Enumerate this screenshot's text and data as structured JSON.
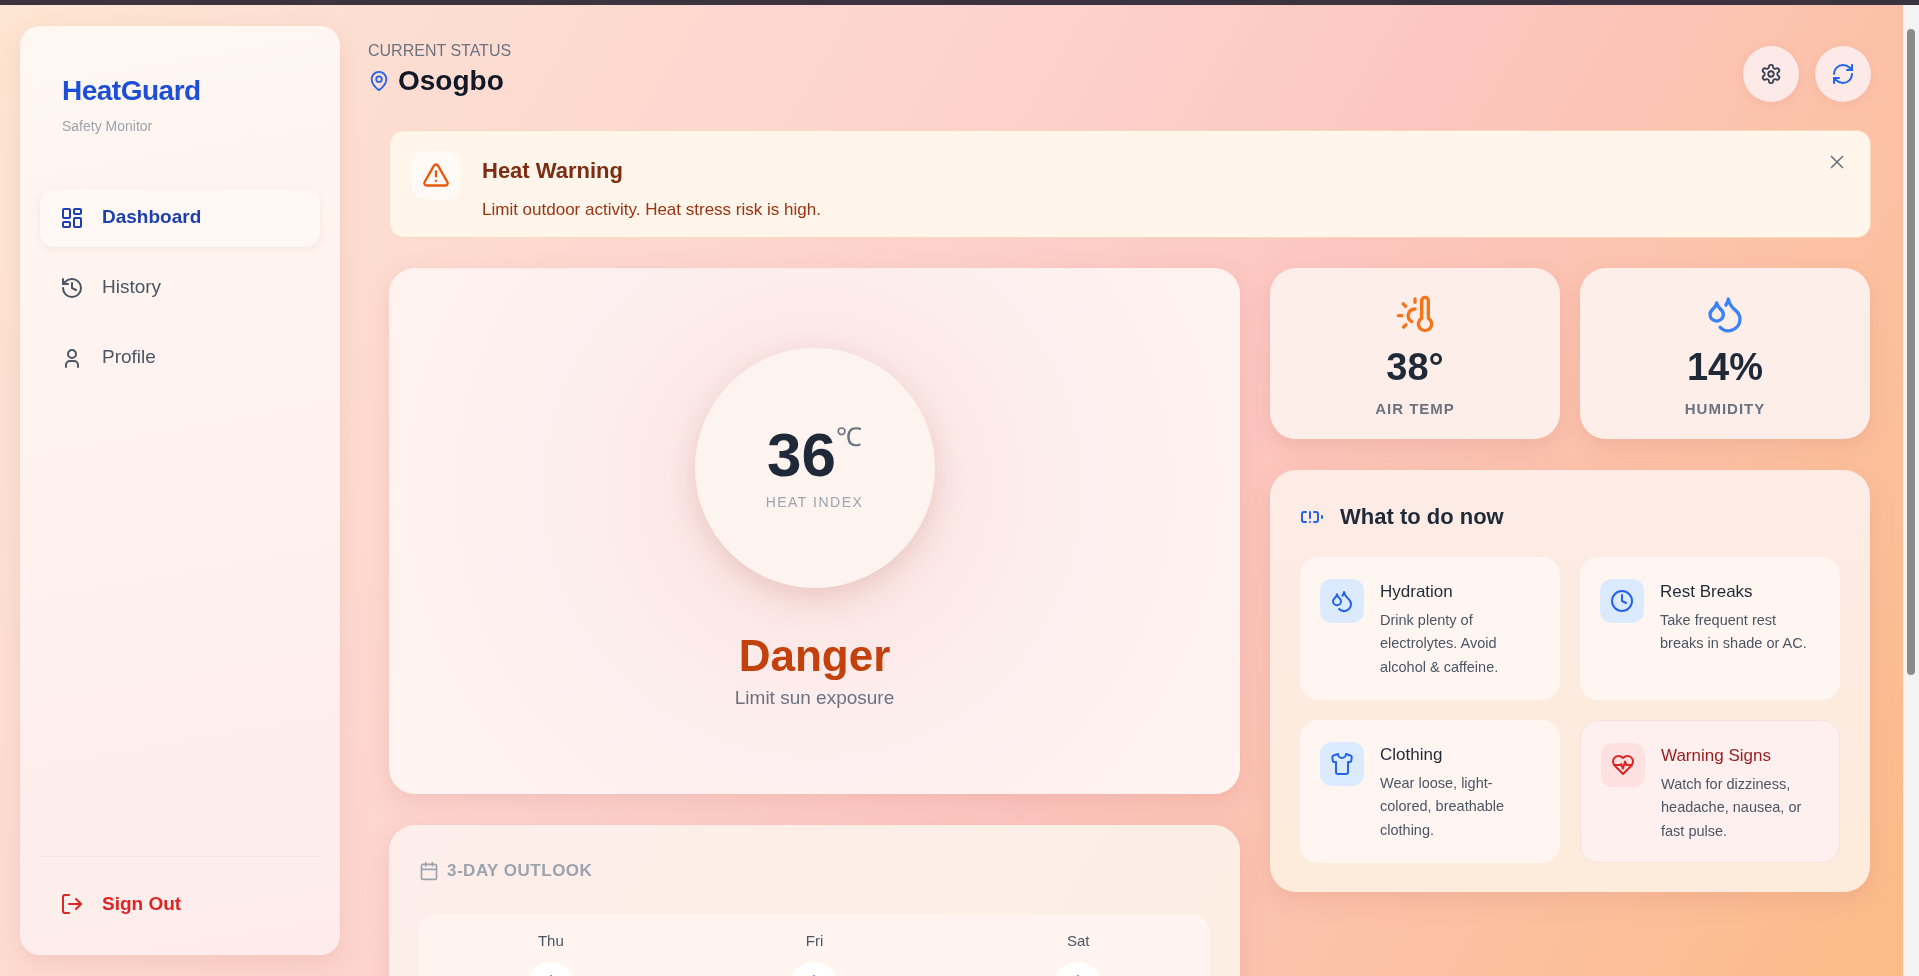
{
  "app": {
    "name": "HeatGuard",
    "tagline": "Safety Monitor"
  },
  "nav": [
    {
      "label": "Dashboard",
      "selected": true
    },
    {
      "label": "History",
      "selected": false
    },
    {
      "label": "Profile",
      "selected": false
    }
  ],
  "sign_out": {
    "label": "Sign Out"
  },
  "header": {
    "eyebrow": "CURRENT STATUS",
    "location": "Osogbo"
  },
  "alert": {
    "title": "Heat Warning",
    "message": "Limit outdoor activity. Heat stress risk is high."
  },
  "heat_index": {
    "value": "36",
    "unit": "℃",
    "label": "HEAT INDEX",
    "risk": "Danger",
    "advice": "Limit sun exposure"
  },
  "stats": [
    {
      "value": "38°",
      "label": "AIR TEMP"
    },
    {
      "value": "14%",
      "label": "HUMIDITY"
    }
  ],
  "actions": {
    "title": "What to do now",
    "items": [
      {
        "title": "Hydration",
        "text": "Drink plenty of electrolytes. Avoid alcohol & caffeine.",
        "kind": "tip"
      },
      {
        "title": "Rest Breaks",
        "text": "Take frequent rest breaks in shade or AC.",
        "kind": "tip"
      },
      {
        "title": "Clothing",
        "text": "Wear loose, light-colored, breathable clothing.",
        "kind": "tip"
      },
      {
        "title": "Warning Signs",
        "text": "Watch for dizziness, headache, nausea, or fast pulse.",
        "kind": "warning"
      }
    ]
  },
  "outlook": {
    "title": "3-DAY OUTLOOK",
    "days": [
      {
        "day": "Thu"
      },
      {
        "day": "Fri"
      },
      {
        "day": "Sat"
      }
    ]
  }
}
